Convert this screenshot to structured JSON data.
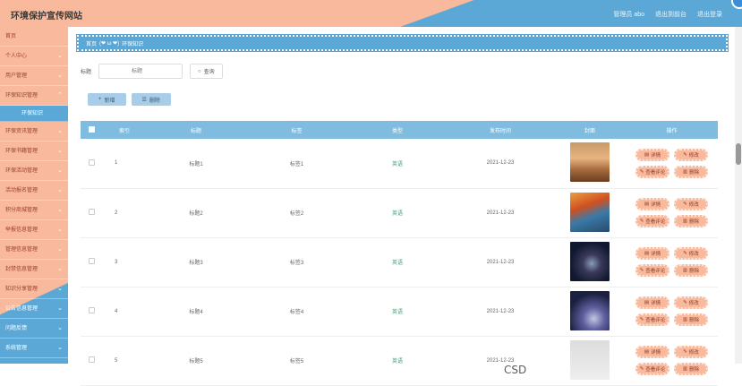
{
  "header": {
    "title": "环境保护宣传网站",
    "admin_label": "管理员 abo",
    "back_label": "退出到前台",
    "logout_label": "退出登录"
  },
  "sidebar": {
    "items": [
      {
        "label": "首页",
        "chevron": ""
      },
      {
        "label": "个人中心",
        "chevron": "⌄"
      },
      {
        "label": "用户管理",
        "chevron": "⌄"
      },
      {
        "label": "环保知识管理",
        "chevron": "⌃"
      },
      {
        "label": "环保知识",
        "chevron": ""
      },
      {
        "label": "环保资讯管理",
        "chevron": "⌄"
      },
      {
        "label": "环保书籍管理",
        "chevron": "⌄"
      },
      {
        "label": "环保活动管理",
        "chevron": "⌄"
      },
      {
        "label": "活动报名管理",
        "chevron": "⌄"
      },
      {
        "label": "积分商城管理",
        "chevron": "⌄"
      },
      {
        "label": "举报信息管理",
        "chevron": "⌄"
      },
      {
        "label": "管理信息管理",
        "chevron": "⌄"
      },
      {
        "label": "封禁信息管理",
        "chevron": "⌄"
      },
      {
        "label": "知识分享管理",
        "chevron": "⌄"
      },
      {
        "label": "公告信息管理",
        "chevron": "⌄"
      },
      {
        "label": "问题反馈",
        "chevron": "⌄"
      },
      {
        "label": "系统管理",
        "chevron": "⌄"
      }
    ]
  },
  "breadcrumb": {
    "home": "首页",
    "sep": "(❤ ω ❤)",
    "current": "环保知识"
  },
  "search": {
    "label": "标题",
    "placeholder": "标题",
    "query_label": "查询"
  },
  "actions": {
    "add_label": "新增",
    "delete_label": "删除"
  },
  "table": {
    "headers": [
      "索引",
      "标题",
      "标签",
      "类型",
      "发布时间",
      "封面",
      "操作"
    ],
    "rows": [
      {
        "index": "1",
        "title": "标题1",
        "tag": "标签1",
        "type": "英语",
        "date": "2021-12-23",
        "cover": "desert"
      },
      {
        "index": "2",
        "title": "标题2",
        "tag": "标签2",
        "type": "英语",
        "date": "2021-12-23",
        "cover": "autumn-lake"
      },
      {
        "index": "3",
        "title": "标题3",
        "tag": "标签3",
        "type": "英语",
        "date": "2021-12-23",
        "cover": "night-sky"
      },
      {
        "index": "4",
        "title": "标题4",
        "tag": "标签4",
        "type": "英语",
        "date": "2021-12-23",
        "cover": "galaxy"
      },
      {
        "index": "5",
        "title": "标题5",
        "tag": "标签5",
        "type": "英语",
        "date": "2021-12-23",
        "cover": "mist"
      }
    ],
    "op_labels": {
      "detail": "详情",
      "edit": "修改",
      "review": "查看评论",
      "delete": "删除"
    }
  },
  "watermark": "CSD",
  "colors": {
    "accent_orange": "#f8b99c",
    "accent_blue": "#5ba8d6",
    "header_table": "#80bcdf"
  }
}
